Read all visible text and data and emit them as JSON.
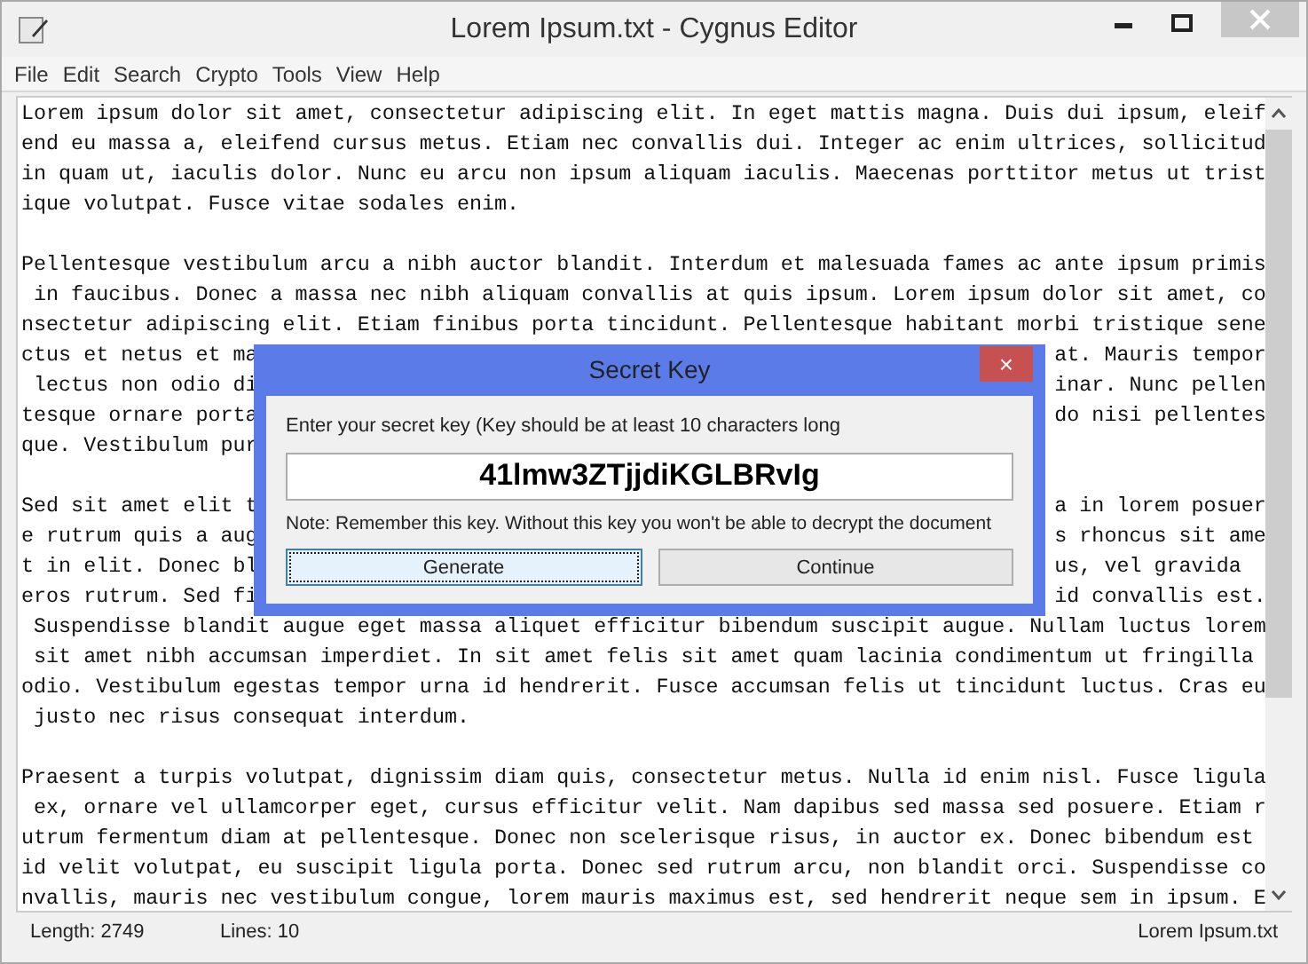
{
  "window": {
    "title": "Lorem Ipsum.txt - Cygnus Editor"
  },
  "menu": [
    "File",
    "Edit",
    "Search",
    "Crypto",
    "Tools",
    "View",
    "Help"
  ],
  "editor": {
    "lines": [
      {
        "kind": "text",
        "text": "Lorem ipsum dolor sit amet, consectetur adipiscing elit. In eget mattis magna. Duis dui ipsum, eleif"
      },
      {
        "kind": "text",
        "text": "end eu massa a, eleifend cursus metus. Etiam nec convallis dui. Integer ac enim ultrices, sollicitud"
      },
      {
        "kind": "text",
        "text": "in quam ut, iaculis dolor. Nunc eu arcu non ipsum aliquam iaculis. Maecenas porttitor metus ut trist"
      },
      {
        "kind": "text",
        "text": "ique volutpat. Fusce vitae sodales enim."
      },
      {
        "kind": "blank"
      },
      {
        "kind": "text",
        "text": "Pellentesque vestibulum arcu a nibh auctor blandit. Interdum et malesuada fames ac ante ipsum primis"
      },
      {
        "kind": "text",
        "text": " in faucibus. Donec a massa nec nibh aliquam convallis at quis ipsum. Lorem ipsum dolor sit amet, co"
      },
      {
        "kind": "text",
        "text": "nsectetur adipiscing elit. Etiam finibus porta tincidunt. Pellentesque habitant morbi tristique sene"
      },
      {
        "kind": "split",
        "left": "ctus et netus et ma",
        "right": "at. Mauris tempor"
      },
      {
        "kind": "split",
        "left": " lectus non odio di",
        "right": "inar. Nunc pellen"
      },
      {
        "kind": "split",
        "left": "tesque ornare porta",
        "right": "do nisi pellentes"
      },
      {
        "kind": "split",
        "left": "que. Vestibulum pur"
      },
      {
        "kind": "blank"
      },
      {
        "kind": "split",
        "left": "Sed sit amet elit t",
        "right": "a in lorem posuer"
      },
      {
        "kind": "split",
        "left": "e rutrum quis a aug",
        "right": "s rhoncus sit ame"
      },
      {
        "kind": "split",
        "left": "t in elit. Donec bl",
        "right": "us, vel gravida "
      },
      {
        "kind": "split",
        "left": "eros rutrum. Sed fi",
        "right": "id convallis est."
      },
      {
        "kind": "text",
        "text": " Suspendisse blandit augue eget massa aliquet efficitur bibendum suscipit augue. Nullam luctus lorem"
      },
      {
        "kind": "text",
        "text": " sit amet nibh accumsan imperdiet. In sit amet felis sit amet quam lacinia condimentum ut fringilla"
      },
      {
        "kind": "text",
        "text": "odio. Vestibulum egestas tempor urna id hendrerit. Fusce accumsan felis ut tincidunt luctus. Cras eu"
      },
      {
        "kind": "text",
        "text": " justo nec risus consequat interdum."
      },
      {
        "kind": "blank"
      },
      {
        "kind": "text",
        "text": "Praesent a turpis volutpat, dignissim diam quis, consectetur metus. Nulla id enim nisl. Fusce ligula"
      },
      {
        "kind": "text",
        "text": " ex, ornare vel ullamcorper eget, cursus efficitur velit. Nam dapibus sed massa sed posuere. Etiam r"
      },
      {
        "kind": "text",
        "text": "utrum fermentum diam at pellentesque. Donec non scelerisque risus, in auctor ex. Donec bibendum est"
      },
      {
        "kind": "text",
        "text": "id velit volutpat, eu suscipit ligula porta. Donec sed rutrum arcu, non blandit orci. Suspendisse co"
      },
      {
        "kind": "text",
        "text": "nvallis, mauris nec vestibulum congue, lorem mauris maximus est, sed hendrerit neque sem in ipsum. E"
      }
    ]
  },
  "status_bar": {
    "length": "Length: 2749",
    "lines": "Lines: 10",
    "file": "Lorem Ipsum.txt"
  },
  "dialog": {
    "title": "Secret Key",
    "close": "×",
    "label": "Enter your secret key (Key should be at least 10 characters long",
    "key": "41lmw3ZTjjdiKGLBRvIg",
    "note": "Note: Remember this key. Without this key you won't be able to decrypt the document",
    "buttons": [
      {
        "label": "Generate",
        "focused": true
      },
      {
        "label": "Continue",
        "focused": false
      }
    ]
  }
}
